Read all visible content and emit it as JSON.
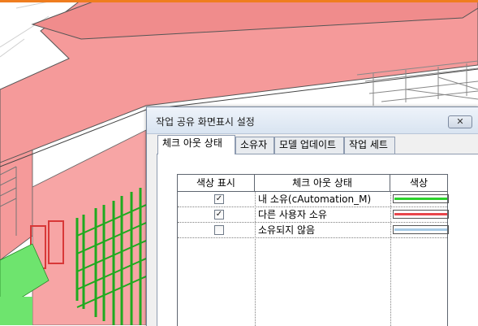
{
  "dialog": {
    "title": "작업 공유 화면표시 설정",
    "close_icon": "close-icon"
  },
  "tabs": [
    {
      "label": "체크 아웃 상태",
      "active": true
    },
    {
      "label": "소유자",
      "active": false
    },
    {
      "label": "모델 업데이트",
      "active": false
    },
    {
      "label": "작업 세트",
      "active": false
    }
  ],
  "table": {
    "headers": [
      "색상 표시",
      "체크 아웃 상태",
      "색상"
    ],
    "rows": [
      {
        "checked": true,
        "status": "내 소유(cAutomation_M)",
        "color": "#2bd12b"
      },
      {
        "checked": true,
        "status": "다른 사용자 소유",
        "color": "#e8454a"
      },
      {
        "checked": false,
        "status": "소유되지 않음",
        "color": "#a6cbe6"
      }
    ]
  },
  "checkmarks": {
    "on": "✓",
    "off": ""
  },
  "colors": {
    "owned_highlight": "#f59a9a",
    "mine_green": "#2bd12b",
    "accent_orange": "#ef7d1f"
  }
}
